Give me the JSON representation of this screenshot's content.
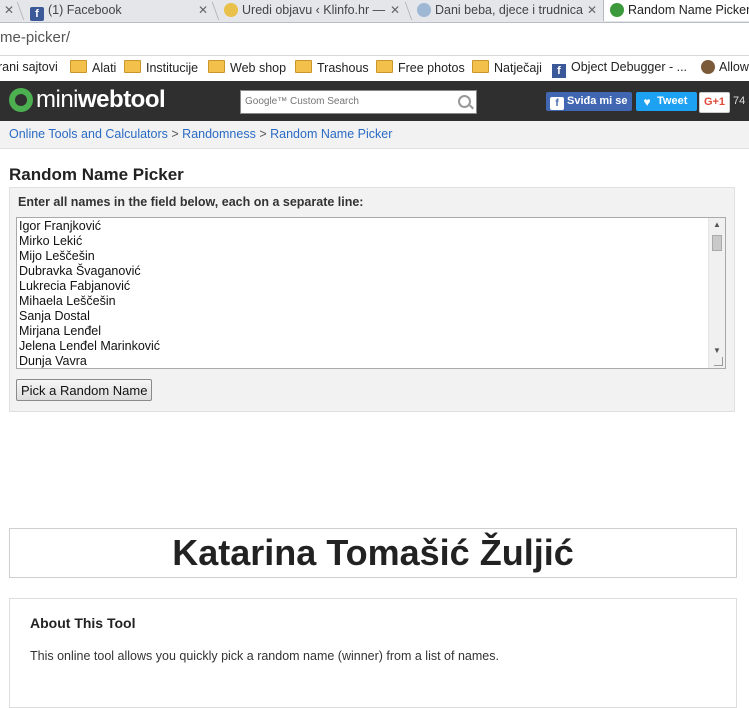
{
  "browser": {
    "tabs": [
      {
        "title": "",
        "active": false
      },
      {
        "title": "(1) Facebook",
        "active": false
      },
      {
        "title": "Uredi objavu ‹ Klinfo.hr —",
        "active": false
      },
      {
        "title": "Dani beba, djece i trudnica",
        "active": false
      },
      {
        "title": "Random Name Picker",
        "active": true
      }
    ],
    "close_glyph": "✕",
    "url": "me-picker/",
    "bookmarks": [
      {
        "label": "rani sajtovi",
        "icon": "folder-icon"
      },
      {
        "label": "Alati",
        "icon": "folder-icon"
      },
      {
        "label": "Institucije",
        "icon": "folder-icon"
      },
      {
        "label": "Web shop",
        "icon": "folder-icon"
      },
      {
        "label": "Trashous",
        "icon": "folder-icon"
      },
      {
        "label": "Free photos",
        "icon": "folder-icon"
      },
      {
        "label": "Natječaji",
        "icon": "folder-icon"
      },
      {
        "label": "Object Debugger - ...",
        "icon": "facebook-icon"
      },
      {
        "label": "Allow",
        "icon": "mailchimp-icon"
      }
    ]
  },
  "header": {
    "logo_light": "mini",
    "logo_bold": "webtool",
    "search_placeholder": "Google™ Custom Search",
    "like_label": "Sviđa mi se",
    "tweet_label": "Tweet",
    "gplus_label": "G+1",
    "gplus_count": "74"
  },
  "breadcrumb": {
    "items": [
      "Online Tools and Calculators",
      "Randomness",
      "Random Name Picker"
    ],
    "separator": ">"
  },
  "main": {
    "title": "Random Name Picker",
    "instructions": "Enter all names in the field below, each on a separate line:",
    "names": [
      "Igor Franjković",
      "Mirko Lekić",
      "Mijo Leščešin",
      "Dubravka Švaganović",
      "Lukrecia Fabjanović",
      "Mihaela Leščešin",
      "Sanja Dostal",
      "Mirjana Lenđel",
      "Jelena Lenđel Marinković",
      "Dunja Vavra"
    ],
    "pick_button": "Pick a Random Name",
    "result": "Katarina Tomašić Žuljić"
  },
  "about": {
    "title": "About This Tool",
    "text": "This online tool allows you quickly pick a random name (winner) from a list of names."
  },
  "colors": {
    "header_bg": "#2f2f2f",
    "link": "#2a6bc4",
    "facebook": "#4267b2",
    "twitter": "#1da1f2"
  }
}
